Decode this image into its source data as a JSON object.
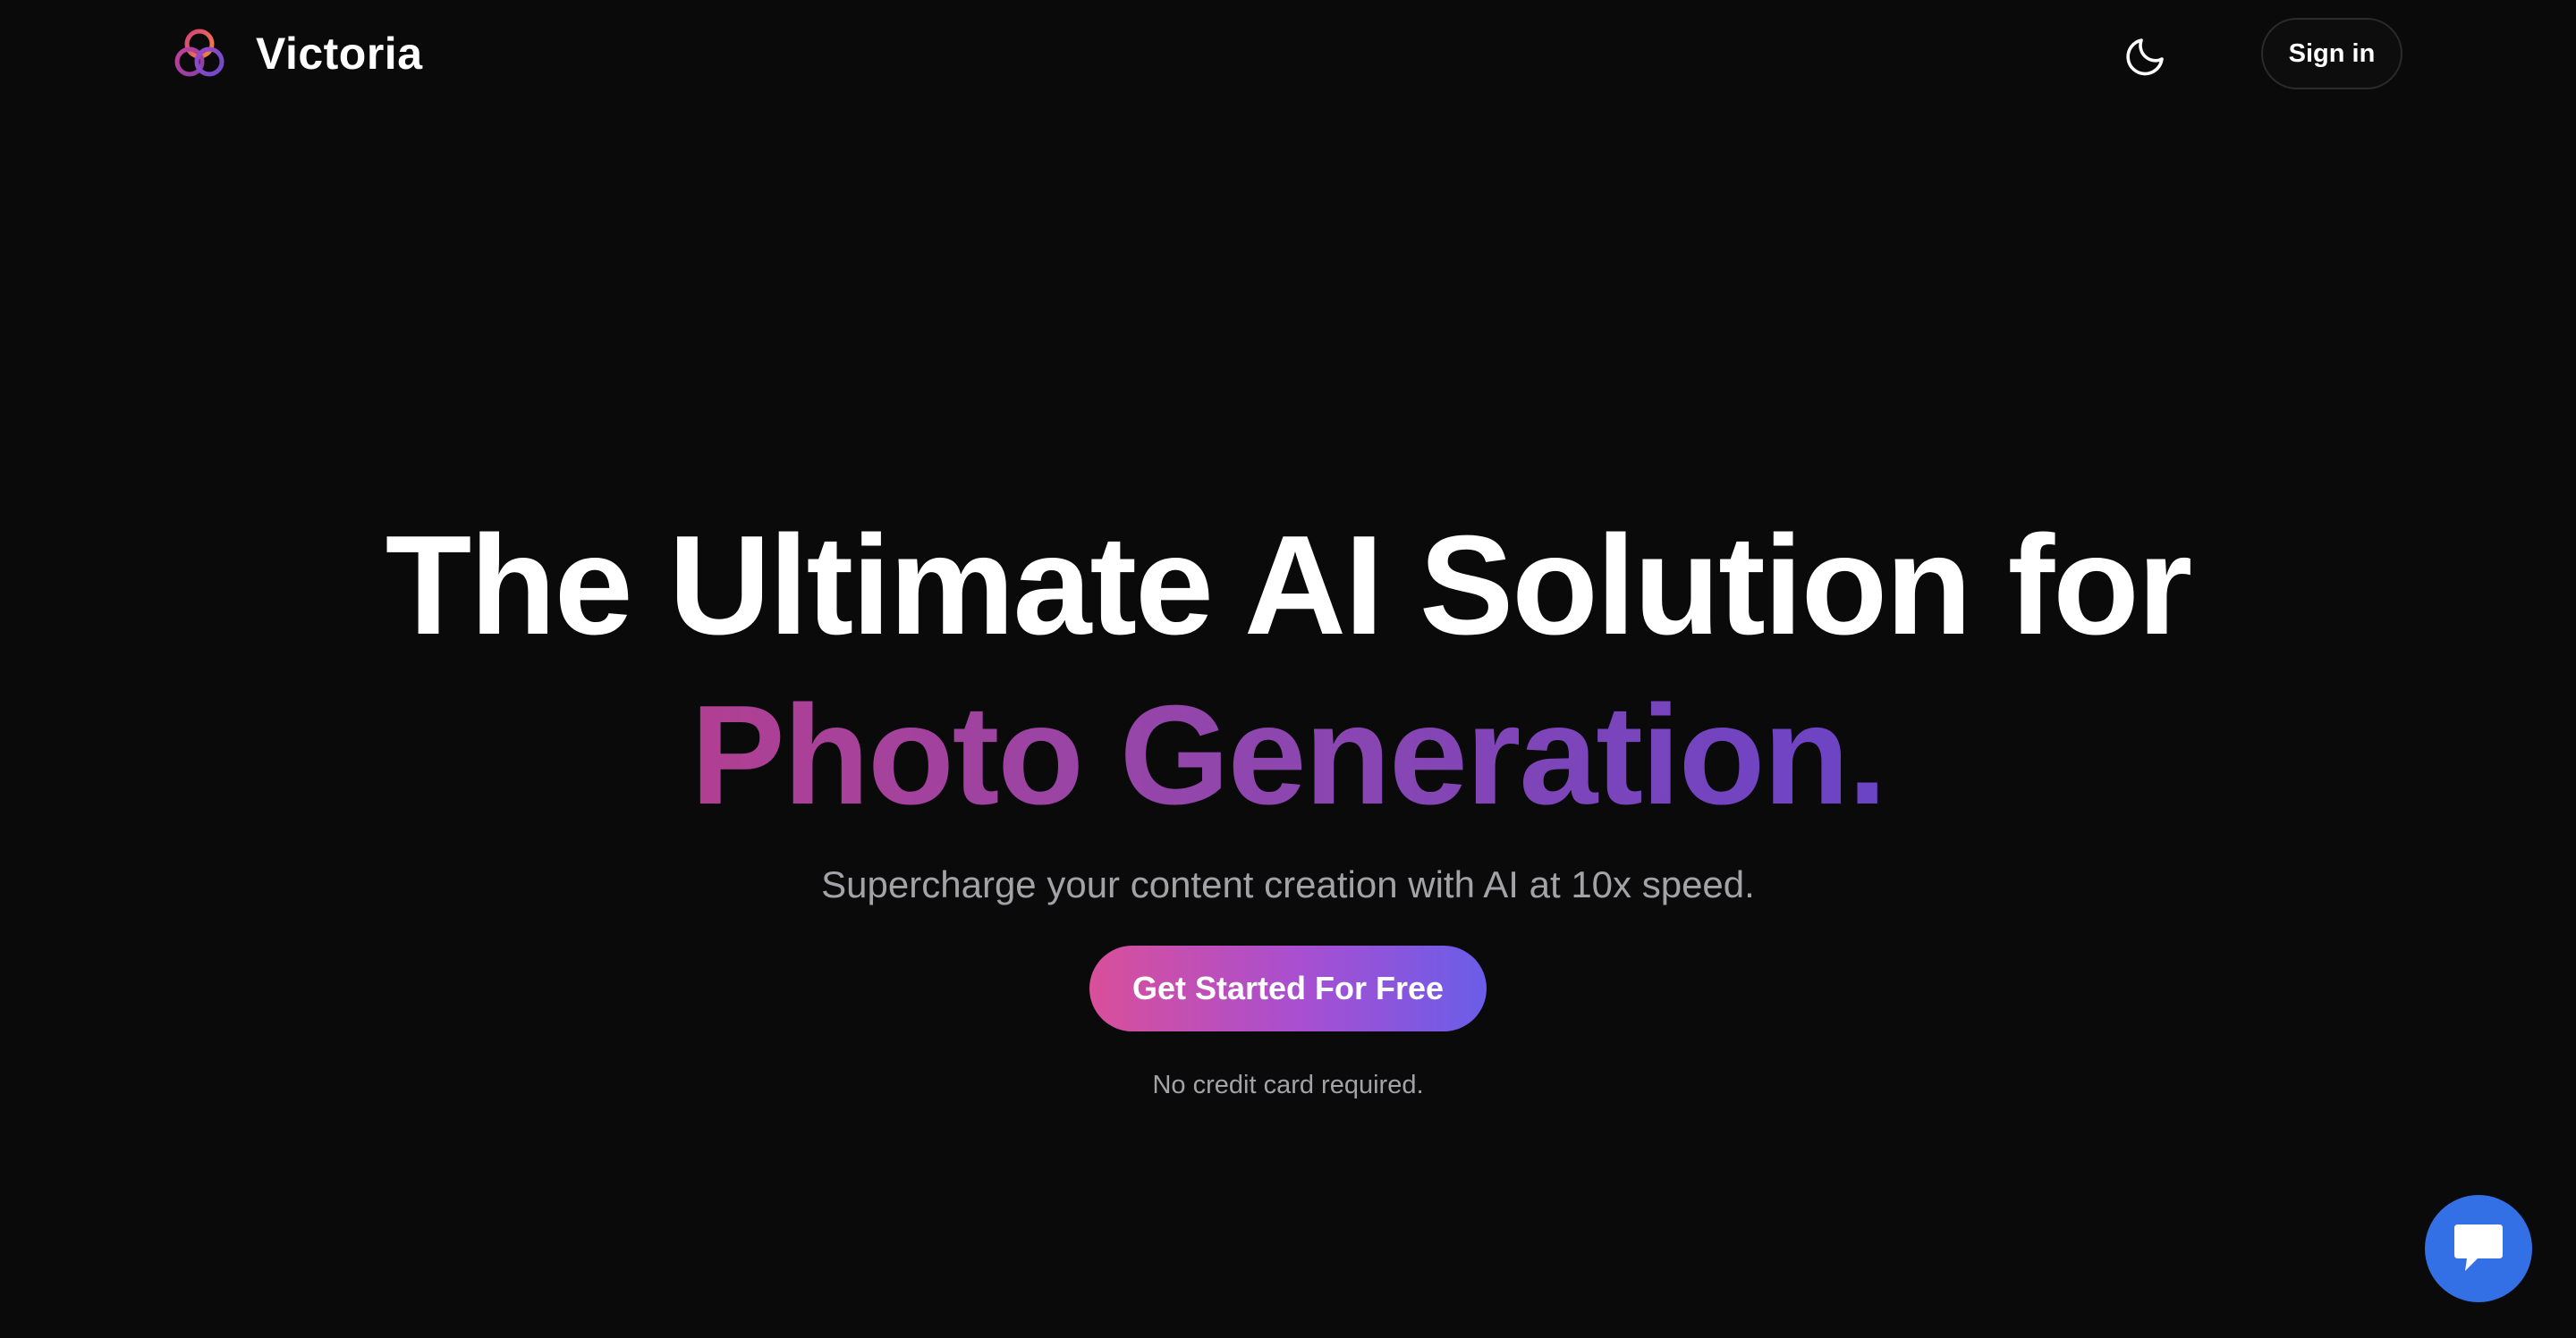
{
  "header": {
    "brand_name": "Victoria",
    "logo_icon": "interlocking-rings-logo-icon",
    "theme_toggle_icon": "moon-icon",
    "sign_in_label": "Sign in"
  },
  "hero": {
    "title_line1": "The Ultimate AI Solution for",
    "title_line2": "Photo Generation.",
    "subtitle": "Supercharge your content creation with AI at 10x speed.",
    "cta_label": "Get Started For Free",
    "cta_note": "No credit card required."
  },
  "chat": {
    "icon": "chat-bubble-icon"
  },
  "colors": {
    "background": "#0b0a0a",
    "gradient_start": "#b13f92",
    "gradient_end": "#6a44c6",
    "cta_start": "#d94f9a",
    "cta_end": "#6a5de8",
    "chat_button": "#3370e5"
  }
}
